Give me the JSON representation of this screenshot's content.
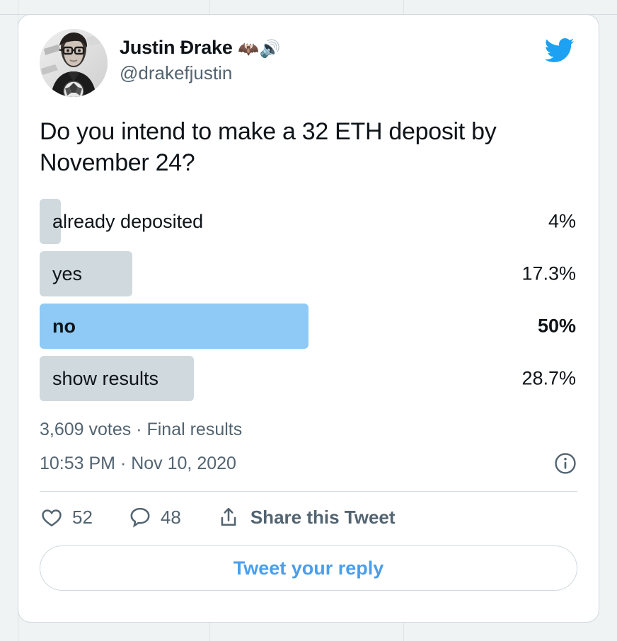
{
  "background": {
    "page_bg": "#eff3f4",
    "column_rule_color": "#dde3e7"
  },
  "card": {
    "bg": "#ffffff",
    "border_color": "#cfd9de"
  },
  "author": {
    "display_name": "Justin Ðrake",
    "name_emoji": "🦇🔊",
    "handle": "@drakefjustin",
    "avatar_alt": "avatar"
  },
  "brand": {
    "logo": "twitter-bird",
    "color": "#1da1f2"
  },
  "tweet": {
    "text": "Do you intend to make a 32 ETH deposit by November 24?"
  },
  "poll": {
    "options": [
      {
        "label": "already deposited",
        "percent": "4%",
        "width_pct": 4.0,
        "winner": false
      },
      {
        "label": "yes",
        "percent": "17.3%",
        "width_pct": 17.3,
        "winner": false
      },
      {
        "label": "no",
        "percent": "50%",
        "width_pct": 50.0,
        "winner": true
      },
      {
        "label": "show results",
        "percent": "28.7%",
        "width_pct": 28.7,
        "winner": false
      }
    ],
    "bar_color": "#cfd9de",
    "winner_bar_color": "#8ecaf5",
    "meta": "3,609 votes · Final results"
  },
  "timestamp": {
    "text": "10:53 PM · Nov 10, 2020",
    "info_icon": "info-circle-icon"
  },
  "actions": {
    "like": {
      "icon": "heart-icon",
      "count": "52"
    },
    "reply": {
      "icon": "comment-icon",
      "count": "48"
    },
    "share": {
      "icon": "share-icon",
      "label": "Share this Tweet"
    }
  },
  "reply_button": {
    "label": "Tweet your reply",
    "color": "#4a9eeb"
  }
}
